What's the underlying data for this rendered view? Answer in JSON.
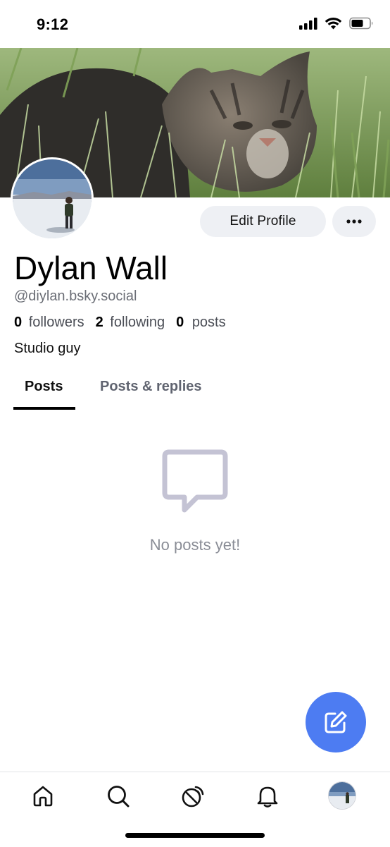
{
  "status_bar": {
    "time": "9:12",
    "icons": [
      "signal-icon",
      "wifi-icon",
      "battery-icon"
    ]
  },
  "profile": {
    "display_name": "Dylan Wall",
    "handle": "@diylan.bsky.social",
    "bio": "Studio guy",
    "stats": {
      "followers_count": "0",
      "followers_label": "followers",
      "following_count": "2",
      "following_label": "following",
      "posts_count": "0",
      "posts_label": "posts"
    },
    "edit_button_label": "Edit Profile",
    "more_icon": "more-horizontal-icon"
  },
  "tabs": [
    {
      "label": "Posts",
      "active": true
    },
    {
      "label": "Posts & replies",
      "active": false
    }
  ],
  "empty_state": {
    "icon": "message-square-icon",
    "text": "No posts yet!"
  },
  "fab": {
    "icon": "compose-icon"
  },
  "bottom_nav": {
    "items": [
      "home-icon",
      "search-icon",
      "feeds-icon",
      "notifications-icon",
      "profile-avatar"
    ]
  },
  "colors": {
    "accent": "#4d7cf2",
    "button_bg": "#eef0f4",
    "muted_text": "#6b6e76",
    "empty_icon": "#c4c3d4"
  }
}
